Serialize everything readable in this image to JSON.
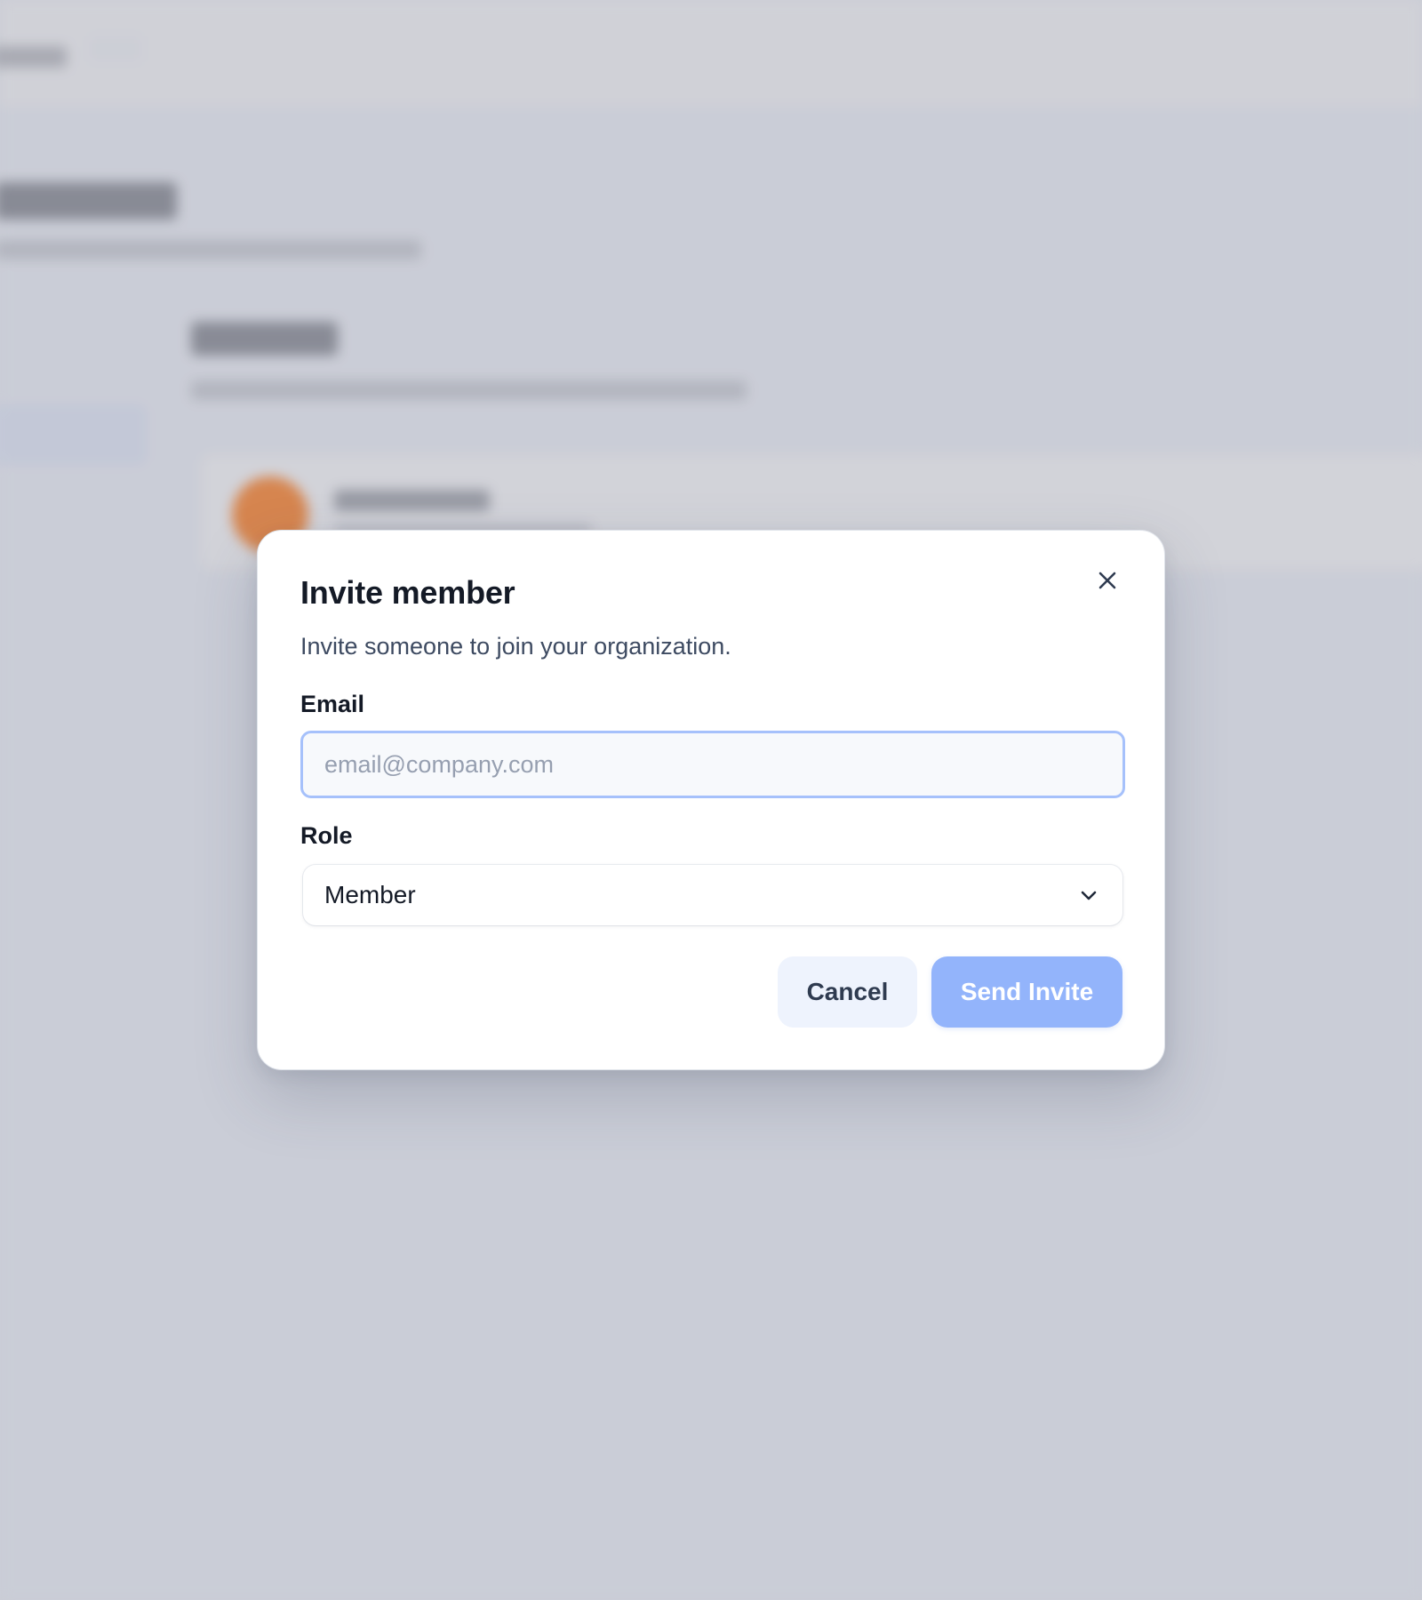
{
  "modal": {
    "title": "Invite member",
    "description": "Invite someone to join your organization.",
    "close_icon": "close-icon",
    "email": {
      "label": "Email",
      "placeholder": "email@company.com",
      "value": ""
    },
    "role": {
      "label": "Role",
      "selected": "Member",
      "icon": "chevron-down-icon"
    },
    "buttons": {
      "cancel_label": "Cancel",
      "send_label": "Send Invite",
      "send_enabled": false
    }
  },
  "colors": {
    "primary_disabled": "#93b4fb",
    "focus_ring": "#a6c1fb",
    "cancel_bg": "#eef3fd",
    "backdrop": "#cbced6",
    "avatar_accent": "#d97a38"
  }
}
